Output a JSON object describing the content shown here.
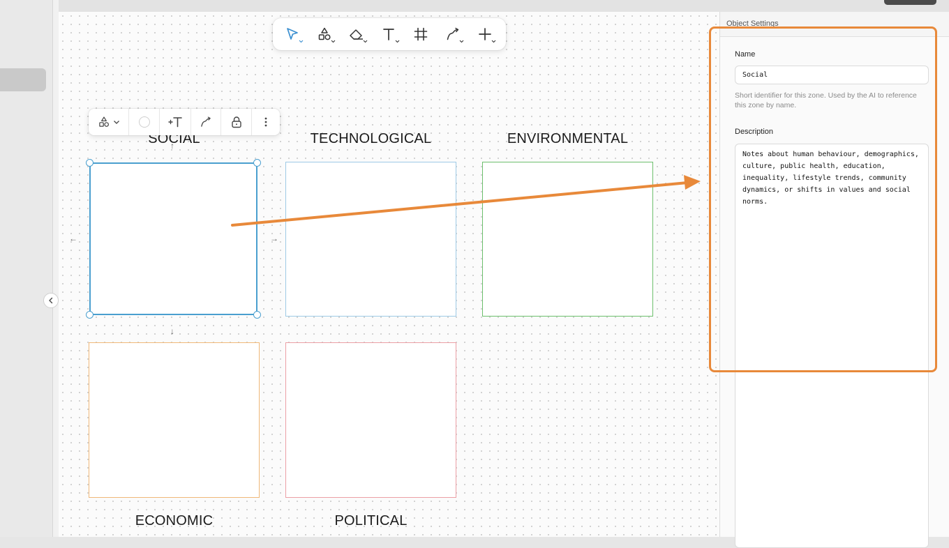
{
  "colors": {
    "accent": "#4a9fcf",
    "annotation": "#e8893a",
    "zone_social": "#4a9fcf",
    "zone_technological": "#9ecae6",
    "zone_environmental": "#6cbf6c",
    "zone_economic": "#f0b878",
    "zone_political": "#ec9fa5"
  },
  "toolbar": {
    "tools": [
      {
        "icon": "select-cursor-icon"
      },
      {
        "icon": "shapes-icon"
      },
      {
        "icon": "eraser-icon"
      },
      {
        "icon": "text-icon"
      },
      {
        "icon": "frame-icon"
      },
      {
        "icon": "connector-icon"
      },
      {
        "icon": "add-icon"
      }
    ]
  },
  "context_toolbar": {
    "items": [
      {
        "icon": "shapes-icon"
      },
      {
        "icon": "color-circle-icon"
      },
      {
        "icon": "add-text-icon"
      },
      {
        "icon": "connector-icon"
      },
      {
        "icon": "lock-icon"
      },
      {
        "icon": "more-vertical-icon"
      }
    ]
  },
  "zones": {
    "social": {
      "label": "SOCIAL"
    },
    "technological": {
      "label": "TECHNOLOGICAL"
    },
    "environmental": {
      "label": "ENVIRONMENTAL"
    },
    "economic": {
      "label": "ECONOMIC"
    },
    "political": {
      "label": "POLITICAL"
    }
  },
  "nudges": {
    "up": "↑",
    "down": "↓",
    "left": "←",
    "right": "→"
  },
  "panel": {
    "title": "Object Settings",
    "name_label": "Name",
    "name_value": "Social",
    "name_hint": "Short identifier for this zone. Used by the AI to reference this zone by name.",
    "description_label": "Description",
    "description_value": "Notes about human behaviour, demographics, culture, public health, education, inequality, lifestyle trends, community dynamics, or shifts in values and social norms."
  }
}
